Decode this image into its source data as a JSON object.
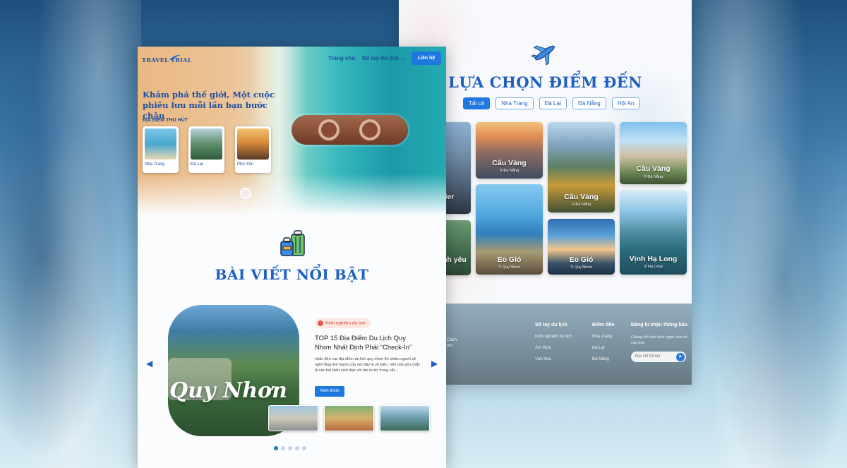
{
  "colors": {
    "brand": "#1f5fbf",
    "accent": "#1f77e0",
    "tag": "#d2453a"
  },
  "home": {
    "logo": "TRAVEL TRIAL",
    "nav": {
      "home": "Trang chủ",
      "handbook": "Sổ tay du lịch",
      "handbook_caret": "⌄",
      "contact": "Liên hệ"
    },
    "hero_title": "Khám phá thế giới, Một cuộc phiêu lưu mỗi lần bạn bước chân",
    "attractions_label": "ĐỊA ĐIỂM THU HÚT",
    "attractions": [
      {
        "label": "Nha Trang"
      },
      {
        "label": "Đà Lạt"
      },
      {
        "label": "Phú Yên"
      }
    ],
    "featured_title": "BÀI VIẾT NỔI BẬT",
    "post": {
      "tag": "Kinh nghiệm du lịch",
      "title": "TOP 15 Địa Điểm Du Lịch Quy Nhơn Nhất Định Phải “Check-In”",
      "desc": "nhắc đến các địa điểm du lịch quy nhơn thì nhiều người sẽ nghĩ rằng thế mạnh của nơi đây là về biển, nên chủ yếu chắc là các bãi biển xinh đẹp với làn nước trong vắt...",
      "more": "Xem thêm",
      "image_text": "Quy Nhơn"
    },
    "arrows": {
      "prev": "◀",
      "next": "▶"
    }
  },
  "destinations": {
    "title": "LỰA CHỌN ĐIỂM ĐẾN",
    "filters": [
      "Tất cả",
      "Nha Trang",
      "Đà Lạt",
      "Đà Nẵng",
      "Hội An"
    ],
    "cards": [
      {
        "name": "Cầu Vàng",
        "loc": "Đà Nẵng"
      },
      {
        "name": "Eo Gió",
        "loc": "Quy Nhơn"
      },
      {
        "name": "Cầu Vàng",
        "loc": "Đà Nẵng"
      },
      {
        "name": "Eo Gió",
        "loc": "Quy Nhơn"
      },
      {
        "name": "Cầu Vàng",
        "loc": "Đà Nẵng"
      },
      {
        "name": "Vịnh Hạ Long",
        "loc": "Hạ Long"
      }
    ],
    "partial": {
      "top": "der",
      "bottom": "nh yêu"
    }
  },
  "footer": {
    "left_bits": "Cách,\nem",
    "col1": {
      "title": "Sổ tay du lịch",
      "items": [
        "Kinh nghiệm du lịch",
        "Ẩm thực",
        "Văn hoá"
      ]
    },
    "col2": {
      "title": "Điểm đến",
      "items": [
        "Nha Trang",
        "Đà Lạt",
        "Đà Nẵng"
      ]
    },
    "col3": {
      "title": "Đăng kí nhận thông báo",
      "sub": "Chúng tôi luôn luôn nghe chia sẻ của bạn",
      "placeholder": "Địa chỉ Email",
      "send": "➤"
    }
  }
}
